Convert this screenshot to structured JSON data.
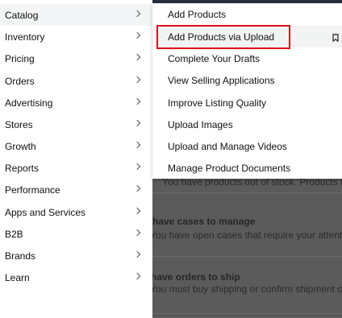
{
  "nav": {
    "items": [
      {
        "label": "Catalog"
      },
      {
        "label": "Inventory"
      },
      {
        "label": "Pricing"
      },
      {
        "label": "Orders"
      },
      {
        "label": "Advertising"
      },
      {
        "label": "Stores"
      },
      {
        "label": "Growth"
      },
      {
        "label": "Reports"
      },
      {
        "label": "Performance"
      },
      {
        "label": "Apps and Services"
      },
      {
        "label": "B2B"
      },
      {
        "label": "Brands"
      },
      {
        "label": "Learn"
      }
    ],
    "active_item": "Catalog",
    "chevron_icon": "chevron-right-icon"
  },
  "submenu": {
    "items": [
      {
        "label": "Add Products"
      },
      {
        "label": "Add Products via Upload"
      },
      {
        "label": "Complete Your Drafts"
      },
      {
        "label": "View Selling Applications"
      },
      {
        "label": "Improve Listing Quality"
      },
      {
        "label": "Upload Images"
      },
      {
        "label": "Upload and Manage Videos"
      },
      {
        "label": "Manage Product Documents"
      }
    ],
    "highlighted_item": "Add Products via Upload",
    "bookmark_icon": "bookmark-icon",
    "highlight_color": "#e3001b"
  },
  "background": {
    "stock_text": "You have products out of stock. Products the",
    "cases_title": "have cases to manage",
    "cases_text": "You have open cases that require your attention",
    "orders_title": "have orders to ship",
    "orders_text": "You must buy shipping or confirm shipment of"
  }
}
